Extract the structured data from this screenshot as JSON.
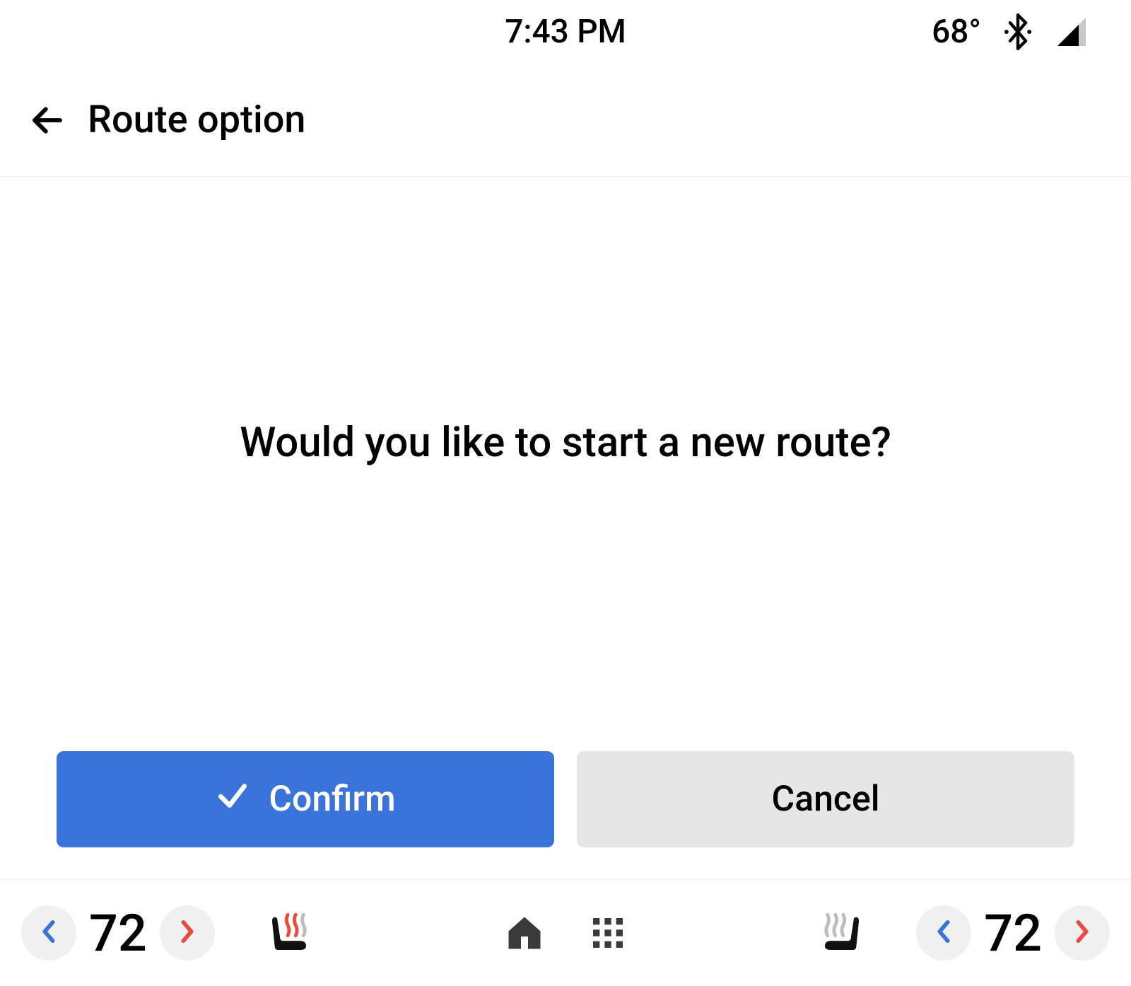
{
  "status": {
    "time": "7:43 PM",
    "temperature": "68°"
  },
  "header": {
    "title": "Route option"
  },
  "prompt": {
    "question": "Would you like to start a new route?"
  },
  "buttons": {
    "confirm": "Confirm",
    "cancel": "Cancel"
  },
  "climate": {
    "left_temp": "72",
    "right_temp": "72"
  },
  "colors": {
    "primary": "#3a73d9",
    "secondary_bg": "#e6e6e6",
    "chevron_cold": "#3a73d9",
    "chevron_hot": "#e74c3c"
  }
}
